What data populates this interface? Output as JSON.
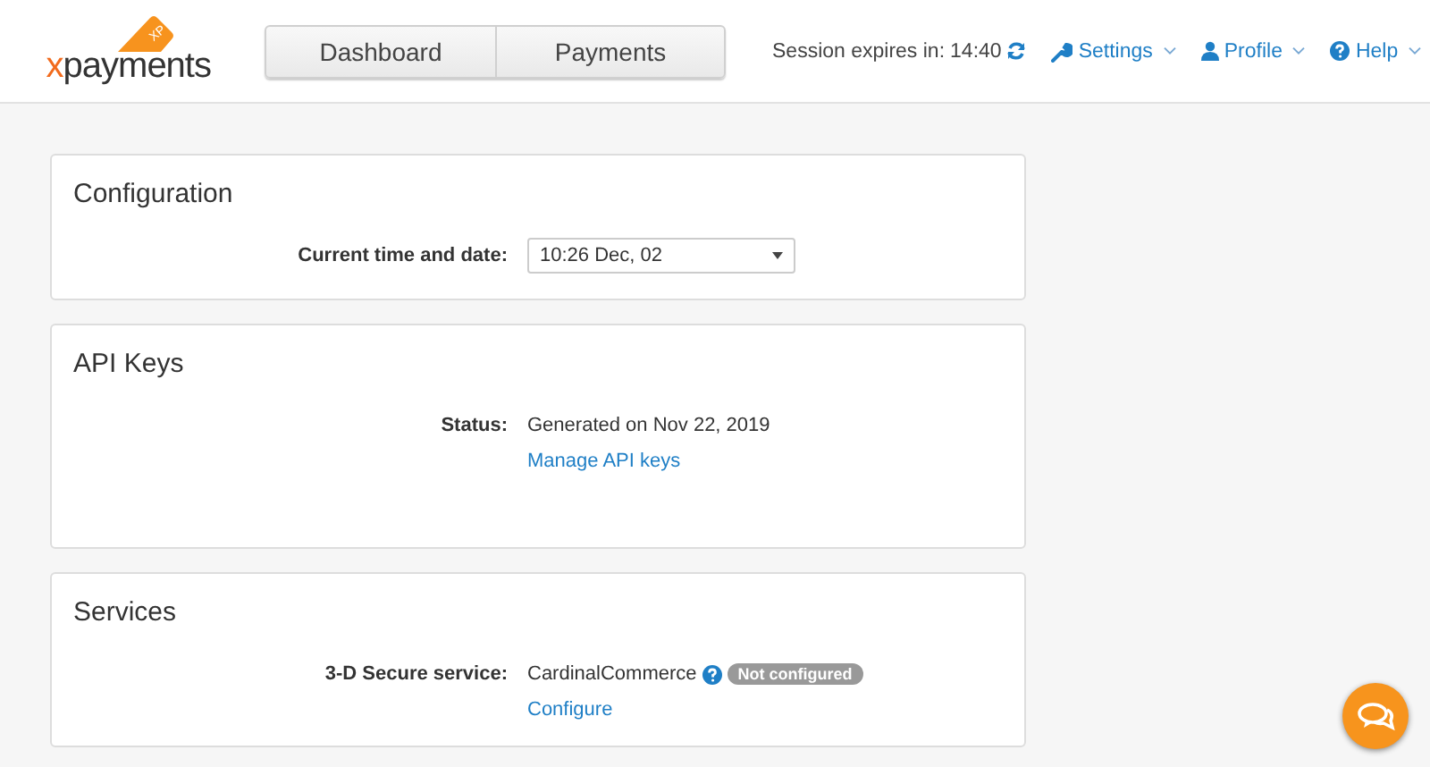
{
  "logo": {
    "badge": "XP",
    "accent": "x",
    "wordmark": "payments"
  },
  "nav_tabs": [
    {
      "label": "Dashboard",
      "selected": false
    },
    {
      "label": "Payments",
      "selected": false
    }
  ],
  "session": {
    "label": "Session expires in:",
    "time": "14:40"
  },
  "menus": [
    {
      "label": "Settings",
      "kind": "settings"
    },
    {
      "label": "Profile",
      "kind": "profile"
    },
    {
      "label": "Help",
      "kind": "help"
    }
  ],
  "sections": [
    {
      "title": "Configuration",
      "rows": [
        {
          "label": "Current time and date:",
          "kind": "select",
          "value": "10:26 Dec, 02"
        }
      ]
    },
    {
      "title": "API Keys",
      "rows": [
        {
          "label": "Status:",
          "kind": "text",
          "value": "Generated on Nov 22, 2019",
          "link": "Manage API keys"
        }
      ]
    },
    {
      "title": "Services",
      "rows": [
        {
          "label": "3-D Secure service:",
          "kind": "service",
          "value": "CardinalCommerce",
          "badge": "Not configured",
          "link": "Configure"
        }
      ]
    }
  ]
}
